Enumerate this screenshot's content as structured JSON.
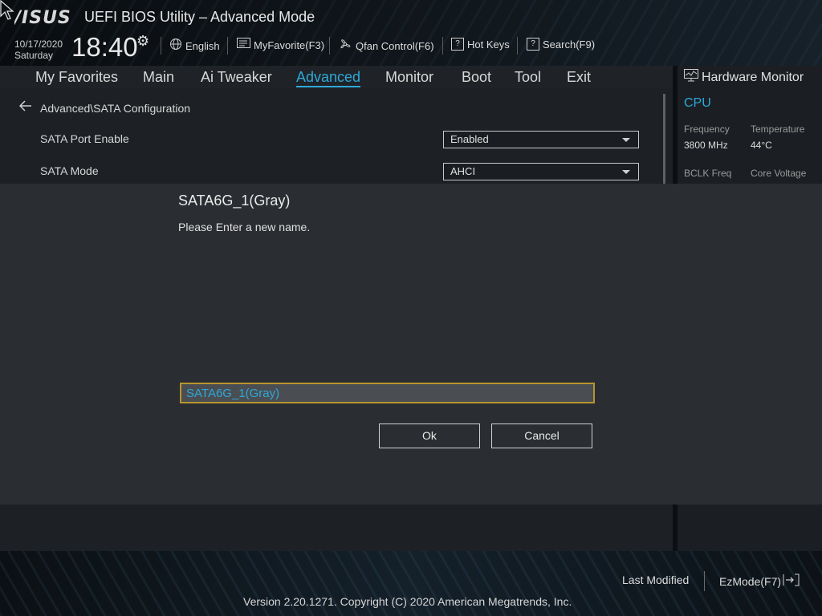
{
  "header": {
    "logo": "/ISUS",
    "title": "UEFI BIOS Utility – Advanced Mode",
    "date": "10/17/2020",
    "day": "Saturday",
    "time": "18:40"
  },
  "toolbar": {
    "language": "English",
    "favorite": "MyFavorite(F3)",
    "qfan": "Qfan Control(F6)",
    "hotkeys": "Hot Keys",
    "search": "Search(F9)"
  },
  "nav": {
    "items": [
      "My Favorites",
      "Main",
      "Ai Tweaker",
      "Advanced",
      "Monitor",
      "Boot",
      "Tool",
      "Exit"
    ],
    "active": "Advanced"
  },
  "main": {
    "breadcrumb": "Advanced\\SATA Configuration",
    "rows": [
      {
        "label": "SATA Port Enable",
        "value": "Enabled"
      },
      {
        "label": "SATA Mode",
        "value": "AHCI"
      }
    ]
  },
  "hardware_monitor": {
    "title": "Hardware Monitor",
    "section": "CPU",
    "frequency_label": "Frequency",
    "frequency_value": "3800 MHz",
    "temperature_label": "Temperature",
    "temperature_value": "44°C",
    "bclk_label": "BCLK Freq",
    "core_voltage_label": "Core Voltage"
  },
  "dialog": {
    "title": "SATA6G_1(Gray)",
    "message": "Please Enter a new name.",
    "input_value": "SATA6G_1(Gray)",
    "ok": "Ok",
    "cancel": "Cancel"
  },
  "footer": {
    "last_modified": "Last Modified",
    "ezmode": "EzMode(F7)",
    "copyright": "Version 2.20.1271. Copyright (C) 2020 American Megatrends, Inc."
  },
  "colors": {
    "accent": "#2fa8d8",
    "input_border": "#b8942e"
  }
}
